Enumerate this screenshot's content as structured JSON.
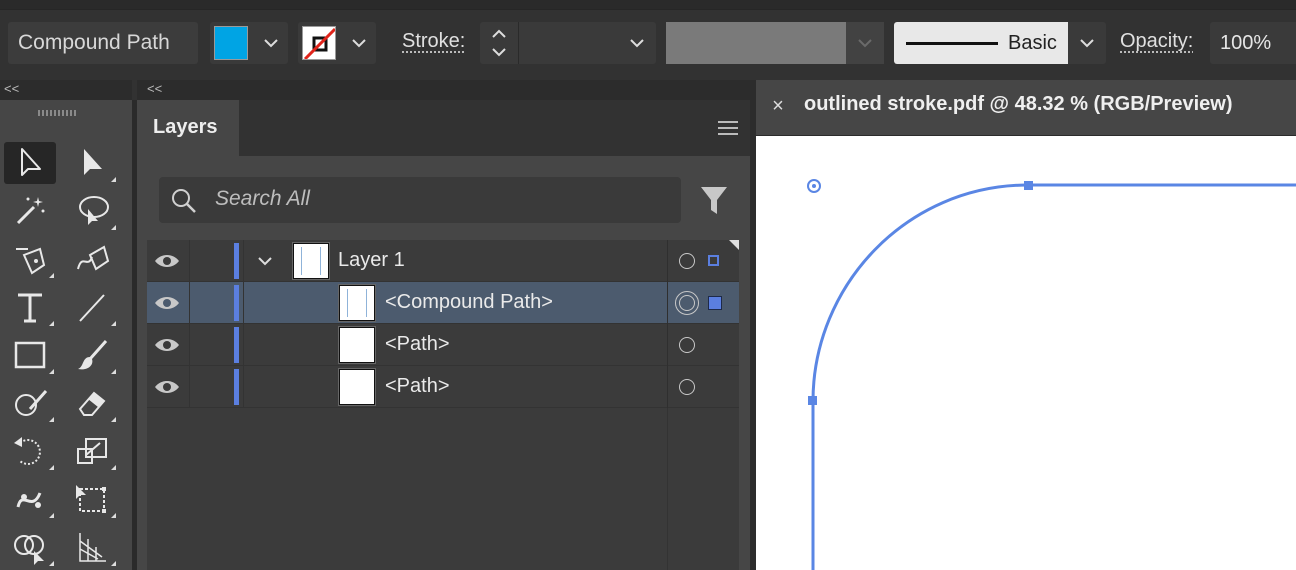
{
  "control_bar": {
    "object_type": "Compound Path",
    "fill_color": "#00a4e4",
    "stroke_label": "Stroke:",
    "stroke_weight": "",
    "brush_label": "Basic",
    "opacity_label": "Opacity:",
    "opacity_value": "100%"
  },
  "panels": {
    "collapse_left": "<<",
    "collapse_layers": "<<"
  },
  "tools": [
    "selection-tool",
    "direct-selection-tool",
    "magic-wand-tool",
    "lasso-tool",
    "pen-tool",
    "curvature-tool",
    "type-tool",
    "line-segment-tool",
    "rectangle-tool",
    "paintbrush-tool",
    "shaper-tool",
    "eraser-tool",
    "rotate-tool",
    "scale-tool",
    "puppet-warp-tool",
    "free-transform-tool",
    "shape-builder-tool",
    "perspective-grid-tool"
  ],
  "layers_panel": {
    "tab_label": "Layers",
    "search_placeholder": "Search All",
    "rows": [
      {
        "name": "Layer 1",
        "expanded": true,
        "selected": false
      },
      {
        "name": "<Compound Path>",
        "selected": true
      },
      {
        "name": "<Path>",
        "selected": false
      },
      {
        "name": "<Path>",
        "selected": false
      }
    ]
  },
  "document": {
    "tab_title": "outlined stroke.pdf @ 48.32 % (RGB/Preview)",
    "close_glyph": "×",
    "path_color": "#5a86e4"
  }
}
